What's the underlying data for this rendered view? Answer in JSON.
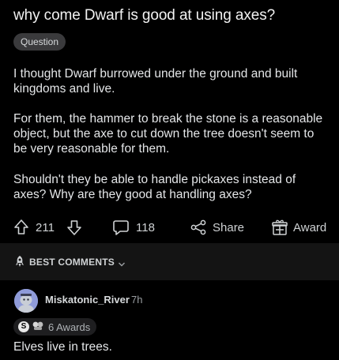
{
  "post": {
    "title": "why come Dwarf is good at using axes?",
    "flair": "Question",
    "paragraphs": [
      "I thought Dwarf burrowed under the ground and built kingdoms and live.",
      "For them, the hammer to break the stone is a reasonable object, but the axe to cut down the tree doesn't seem to be very reasonable for them.",
      "Shouldn't they be able to handle pickaxes instead of axes? Why are they good at handling axes?"
    ]
  },
  "actions": {
    "upvotes": "211",
    "comments": "118",
    "share_label": "Share",
    "award_label": "Award",
    "icons": [
      "upvote-icon",
      "downvote-icon",
      "comment-icon",
      "share-icon",
      "award-icon"
    ]
  },
  "sort": {
    "label": "BEST COMMENTS",
    "icons": [
      "rocket-icon",
      "chevron-down-icon"
    ]
  },
  "comment": {
    "author": "Miskatonic_River",
    "time": "7h",
    "award_coin": "S",
    "awards_label": "6 Awards",
    "text": "Elves live in trees."
  },
  "colors": {
    "background": "#000000",
    "sort_bar": "#141414",
    "text": "#d7dadc",
    "flair_bg": "#3a3a3c",
    "avatar": "#8f9bd9"
  }
}
